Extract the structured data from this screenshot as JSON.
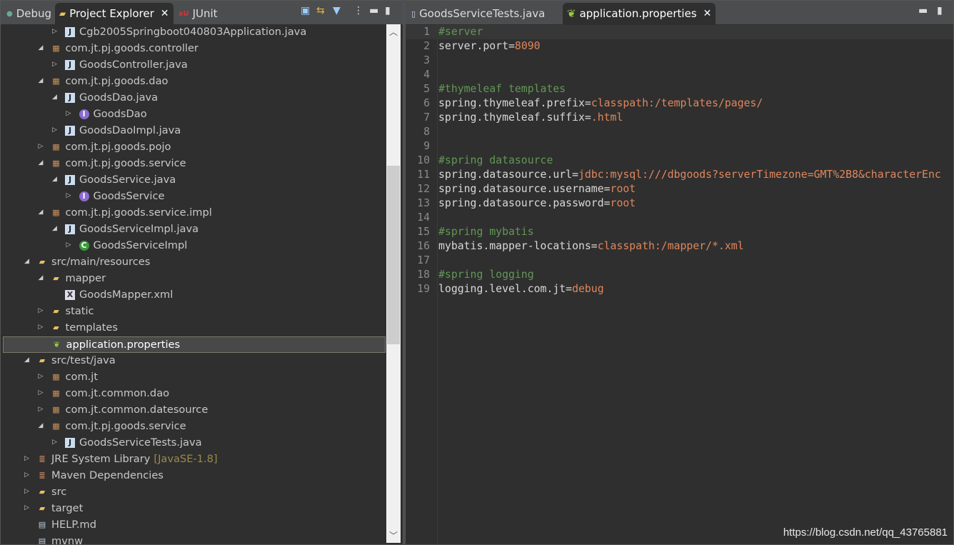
{
  "left_tabs": [
    {
      "label": "Debug",
      "icon": "debug-icon"
    },
    {
      "label": "Project Explorer",
      "icon": "project-explorer-icon",
      "active": true
    },
    {
      "label": "JUnit",
      "icon": "junit-icon"
    }
  ],
  "left_toolbar": [
    "collapse-all-icon",
    "link-editor-icon",
    "filter-icon",
    "view-menu-icon",
    "minimize-icon",
    "maximize-icon"
  ],
  "tree": [
    {
      "label": "Cgb2005Springboot040803Application.java",
      "level": 2,
      "arrow": "collapsed",
      "icon": "java-file"
    },
    {
      "label": "com.jt.pj.goods.controller",
      "level": 1,
      "arrow": "expanded",
      "icon": "package"
    },
    {
      "label": "GoodsController.java",
      "level": 2,
      "arrow": "collapsed",
      "icon": "java-file"
    },
    {
      "label": "com.jt.pj.goods.dao",
      "level": 1,
      "arrow": "expanded",
      "icon": "package-warn"
    },
    {
      "label": "GoodsDao.java",
      "level": 2,
      "arrow": "expanded",
      "icon": "java-file-warn"
    },
    {
      "label": "GoodsDao",
      "level": 3,
      "arrow": "collapsed",
      "icon": "interface"
    },
    {
      "label": "GoodsDaoImpl.java",
      "level": 2,
      "arrow": "collapsed",
      "icon": "java-file-warn"
    },
    {
      "label": "com.jt.pj.goods.pojo",
      "level": 1,
      "arrow": "collapsed",
      "icon": "package-warn"
    },
    {
      "label": "com.jt.pj.goods.service",
      "level": 1,
      "arrow": "expanded",
      "icon": "package"
    },
    {
      "label": "GoodsService.java",
      "level": 2,
      "arrow": "expanded",
      "icon": "java-file"
    },
    {
      "label": "GoodsService",
      "level": 3,
      "arrow": "collapsed",
      "icon": "interface"
    },
    {
      "label": "com.jt.pj.goods.service.impl",
      "level": 1,
      "arrow": "expanded",
      "icon": "package"
    },
    {
      "label": "GoodsServiceImpl.java",
      "level": 2,
      "arrow": "expanded",
      "icon": "java-file"
    },
    {
      "label": "GoodsServiceImpl",
      "level": 3,
      "arrow": "collapsed",
      "icon": "class"
    },
    {
      "label": "src/main/resources",
      "level": 0,
      "arrow": "expanded",
      "icon": "source-folder"
    },
    {
      "label": "mapper",
      "level": 1,
      "arrow": "expanded",
      "icon": "folder-open"
    },
    {
      "label": "GoodsMapper.xml",
      "level": 2,
      "arrow": "none",
      "icon": "xml-file"
    },
    {
      "label": "static",
      "level": 1,
      "arrow": "collapsed",
      "icon": "folder"
    },
    {
      "label": "templates",
      "level": 1,
      "arrow": "collapsed",
      "icon": "folder"
    },
    {
      "label": "application.properties",
      "level": 1,
      "arrow": "none",
      "icon": "spring-leaf",
      "selected": true
    },
    {
      "label": "src/test/java",
      "level": 0,
      "arrow": "expanded",
      "icon": "source-folder-warn"
    },
    {
      "label": "com.jt",
      "level": 1,
      "arrow": "collapsed",
      "icon": "package"
    },
    {
      "label": "com.jt.common.dao",
      "level": 1,
      "arrow": "collapsed",
      "icon": "package"
    },
    {
      "label": "com.jt.common.datesource",
      "level": 1,
      "arrow": "collapsed",
      "icon": "package-warn"
    },
    {
      "label": "com.jt.pj.goods.service",
      "level": 1,
      "arrow": "expanded",
      "icon": "package"
    },
    {
      "label": "GoodsServiceTests.java",
      "level": 2,
      "arrow": "collapsed",
      "icon": "java-file"
    },
    {
      "label": "JRE System Library",
      "decoration": "[JavaSE-1.8]",
      "level": 0,
      "arrow": "collapsed",
      "icon": "library"
    },
    {
      "label": "Maven Dependencies",
      "level": 0,
      "arrow": "collapsed",
      "icon": "library"
    },
    {
      "label": "src",
      "level": 0,
      "arrow": "collapsed",
      "icon": "folder"
    },
    {
      "label": "target",
      "level": 0,
      "arrow": "collapsed",
      "icon": "folder"
    },
    {
      "label": "HELP.md",
      "level": 0,
      "arrow": "none",
      "icon": "text-file"
    },
    {
      "label": "mvnw",
      "level": 0,
      "arrow": "none",
      "icon": "text-file"
    }
  ],
  "editor_tabs": [
    {
      "label": "GoodsServiceTests.java",
      "icon": "java-file-icon"
    },
    {
      "label": "application.properties",
      "icon": "spring-leaf-icon",
      "active": true
    }
  ],
  "editor_lines": [
    {
      "n": "1",
      "comment": "#server"
    },
    {
      "n": "2",
      "key": "server.port=",
      "value": "8090"
    },
    {
      "n": "3"
    },
    {
      "n": "4"
    },
    {
      "n": "5",
      "comment": "#thymeleaf templates"
    },
    {
      "n": "6",
      "key": "spring.thymeleaf.prefix=",
      "value": "classpath:/templates/pages/"
    },
    {
      "n": "7",
      "key": "spring.thymeleaf.suffix=",
      "value": ".html"
    },
    {
      "n": "8"
    },
    {
      "n": "9"
    },
    {
      "n": "10",
      "comment": "#spring datasource"
    },
    {
      "n": "11",
      "key": "spring.datasource.url=",
      "value": "jdbc:mysql:///dbgoods?serverTimezone=GMT%2B8&characterEnc"
    },
    {
      "n": "12",
      "key": "spring.datasource.username=",
      "value": "root"
    },
    {
      "n": "13",
      "key": "spring.datasource.password=",
      "value": "root"
    },
    {
      "n": "14"
    },
    {
      "n": "15",
      "comment": "#spring mybatis"
    },
    {
      "n": "16",
      "key": "mybatis.mapper-locations=",
      "value": "classpath:/mapper/*.xml"
    },
    {
      "n": "17"
    },
    {
      "n": "18",
      "comment": "#spring logging"
    },
    {
      "n": "19",
      "key": "logging.level.com.jt=",
      "value": "debug"
    }
  ],
  "watermark": "https://blog.csdn.net/qq_43765881",
  "colors": {
    "comment": "#629755",
    "value": "#e0865c",
    "background": "#2f2f2f"
  }
}
